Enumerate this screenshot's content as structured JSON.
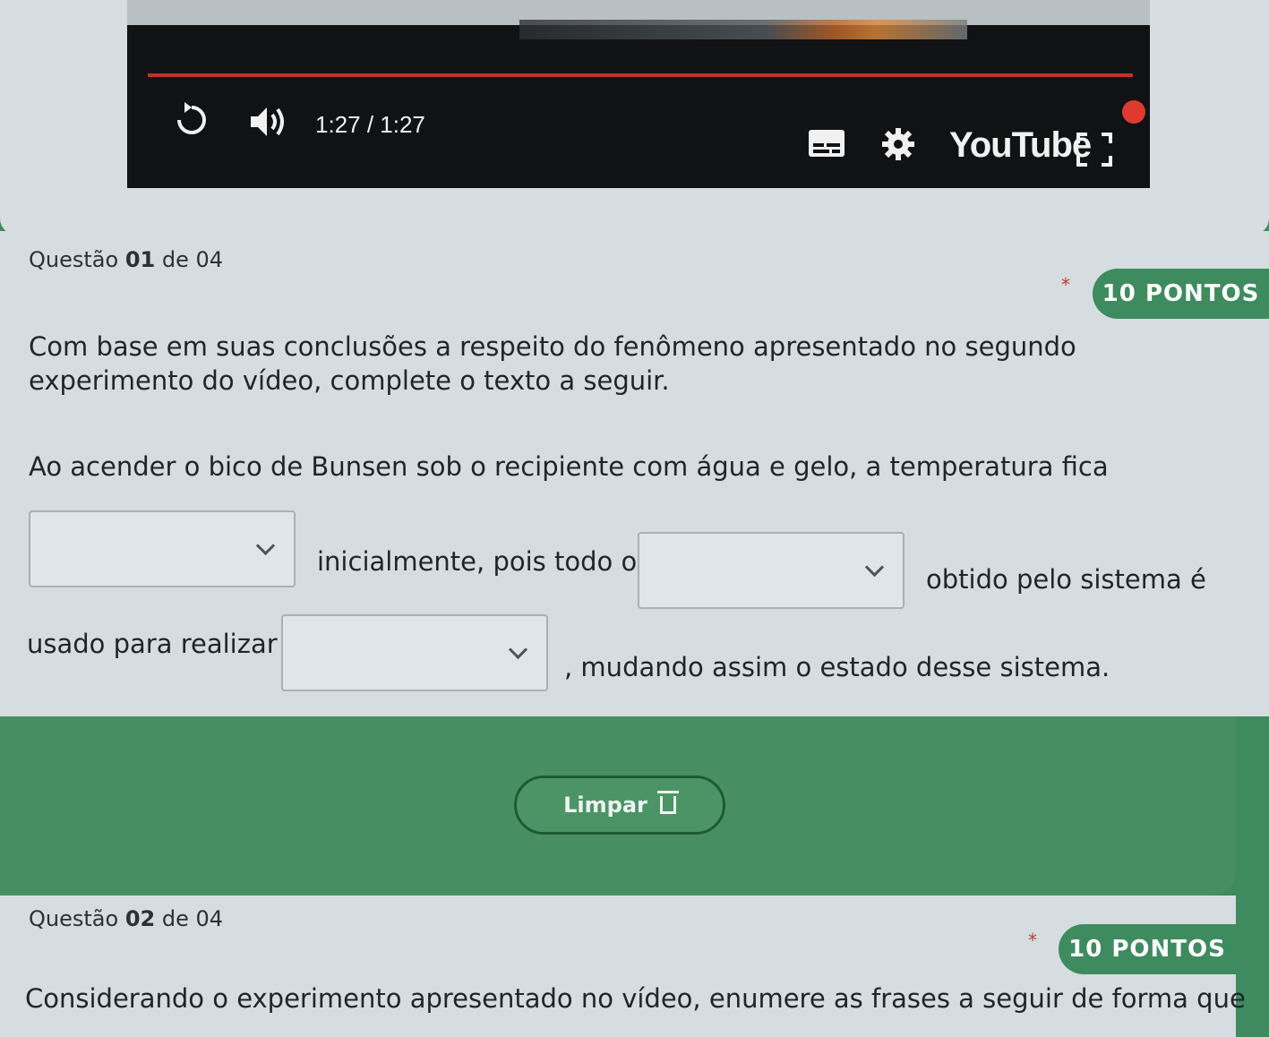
{
  "video": {
    "time": "1:27 / 1:27",
    "brand": "YouTube",
    "icons": [
      "replay-icon",
      "volume-icon",
      "subtitles-icon",
      "settings-icon",
      "fullscreen-icon"
    ]
  },
  "question1": {
    "label_prefix": "Questão ",
    "number": "01",
    "label_suffix": " de 04",
    "points": "10 PONTOS",
    "required_mark": "*",
    "prompt": "Com base em suas conclusões a respeito do fenômeno apresentado no segundo experimento do vídeo, complete o texto a seguir.",
    "text_part1": "Ao acender o bico de Bunsen sob o recipiente com água e gelo, a temperatura fica",
    "text_part2": "inicialmente, pois todo o",
    "text_part3": "obtido pelo sistema é",
    "text_part4": "usado para realizar",
    "text_part5": ", mudando assim o estado desse sistema.",
    "clear_label": "Limpar"
  },
  "question2": {
    "label_prefix": "Questão ",
    "number": "02",
    "label_suffix": " de 04",
    "points": "10 PONTOS",
    "required_mark": "*",
    "prompt": "Considerando o experimento apresentado no vídeo, enumere as frases a seguir de forma que"
  },
  "colors": {
    "accent_green": "#3e8b5f",
    "card_bg": "#d6dde1",
    "progress_red": "#c23226"
  }
}
